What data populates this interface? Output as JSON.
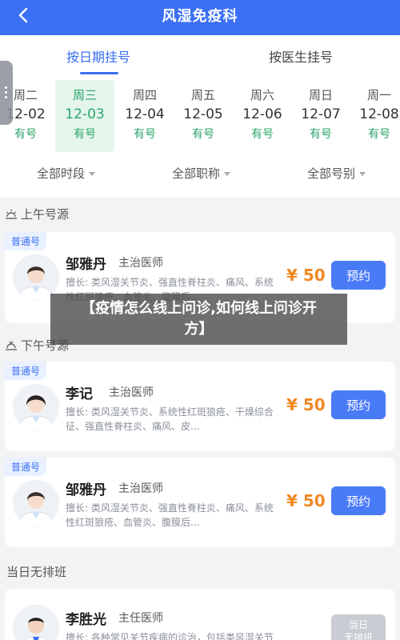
{
  "header": {
    "title": "风湿免疫科"
  },
  "reg_tabs": [
    {
      "label": "按日期挂号"
    },
    {
      "label": "按医生挂号"
    }
  ],
  "dates": [
    {
      "weekday": "周二",
      "date": "12-02",
      "status": "有号"
    },
    {
      "weekday": "周三",
      "date": "12-03",
      "status": "有号"
    },
    {
      "weekday": "周四",
      "date": "12-04",
      "status": "有号"
    },
    {
      "weekday": "周五",
      "date": "12-05",
      "status": "有号"
    },
    {
      "weekday": "周六",
      "date": "12-06",
      "status": "有号"
    },
    {
      "weekday": "周日",
      "date": "12-07",
      "status": "有号"
    },
    {
      "weekday": "周一",
      "date": "12-08",
      "status": "有号"
    }
  ],
  "filters": [
    {
      "label": "全部时段"
    },
    {
      "label": "全部职称"
    },
    {
      "label": "全部号别"
    }
  ],
  "sections": {
    "morning": "上午号源",
    "afternoon": "下午号源",
    "today": "当日无排班"
  },
  "doctors": [
    {
      "badge": "普通号",
      "name": "邹雅丹",
      "title": "主治医师",
      "desc": "擅长:  类风湿关节炎、强直性脊柱炎、痛风、系统性红斑狼疮、血管炎、腹膜后...",
      "price": "¥ 50",
      "button": "预约"
    },
    {
      "badge": "普通号",
      "name": "李记",
      "title": "主治医师",
      "desc": "擅长:  类风湿关节炎、系统性红斑狼疮、干燥综合征、强直性脊柱炎、痛风、皮...",
      "price": "¥ 50",
      "button": "预约"
    },
    {
      "badge": "普通号",
      "name": "邹雅丹",
      "title": "主治医师",
      "desc": "擅长:  类风湿关节炎、强直性脊柱炎、痛风、系统性红斑狼疮、血管炎、腹膜后...",
      "price": "¥ 50",
      "button": "预约"
    },
    {
      "badge": "",
      "name": "李胜光",
      "title": "主任医师",
      "desc": "擅长:  各种常见关节疾病的诊治，包括类风湿关节",
      "price": "",
      "button_line1": "当日",
      "button_line2": "无排班"
    }
  ],
  "overlay": {
    "line1": "【疫情怎么线上问诊,如何线上问诊开",
    "line2": "方】"
  },
  "colors": {
    "primary": "#3b6ff5",
    "available": "#2ba46a",
    "price": "#f08a24",
    "selected_bg": "#e4f6ec"
  }
}
